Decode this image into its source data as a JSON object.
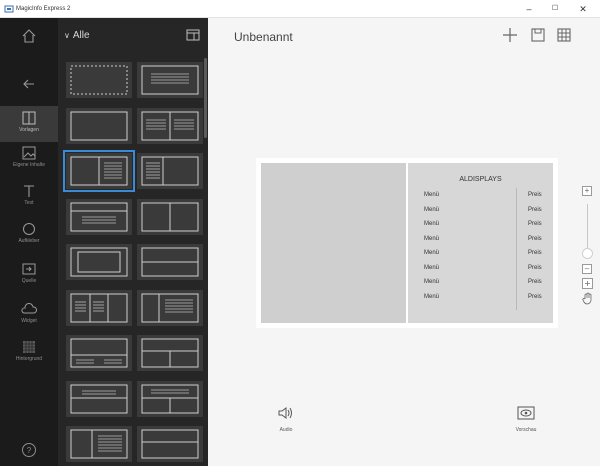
{
  "window": {
    "title": "MagicInfo Express 2",
    "minimize": "–",
    "maximize": "☐",
    "close": "✕"
  },
  "rail": {
    "items": [
      {
        "name": "home",
        "label": ""
      },
      {
        "name": "back",
        "label": ""
      },
      {
        "name": "vorlagen",
        "label": "Vorlagen"
      },
      {
        "name": "eigene-inhalte",
        "label": "Eigene Inhalte"
      },
      {
        "name": "text",
        "label": "Text"
      },
      {
        "name": "aufkleber",
        "label": "Aufkleber"
      },
      {
        "name": "quelle",
        "label": "Quelle"
      },
      {
        "name": "widget",
        "label": "Widget"
      },
      {
        "name": "hintergrund",
        "label": "Hintergrund"
      }
    ],
    "help": "?"
  },
  "panel": {
    "filter_label": "Alle"
  },
  "document": {
    "title": "Unbenannt"
  },
  "stage": {
    "heading": "ALDISPLAYS",
    "menu_items": [
      "Menü",
      "Menü",
      "Menü",
      "Menü",
      "Menü",
      "Menü",
      "Menü",
      "Menü"
    ],
    "price_items": [
      "Preis",
      "Preis",
      "Preis",
      "Preis",
      "Preis",
      "Preis",
      "Preis",
      "Preis"
    ]
  },
  "zoom": {
    "plus": "+",
    "minus": "–",
    "level": 0.15
  },
  "bottom": {
    "audio": "Audio",
    "preview": "Vorschau"
  },
  "colors": {
    "rail_bg": "#1b1b1b",
    "panel_bg": "#262626",
    "accent": "#3a8bd6",
    "canvas_bg": "#f5f5f5"
  }
}
